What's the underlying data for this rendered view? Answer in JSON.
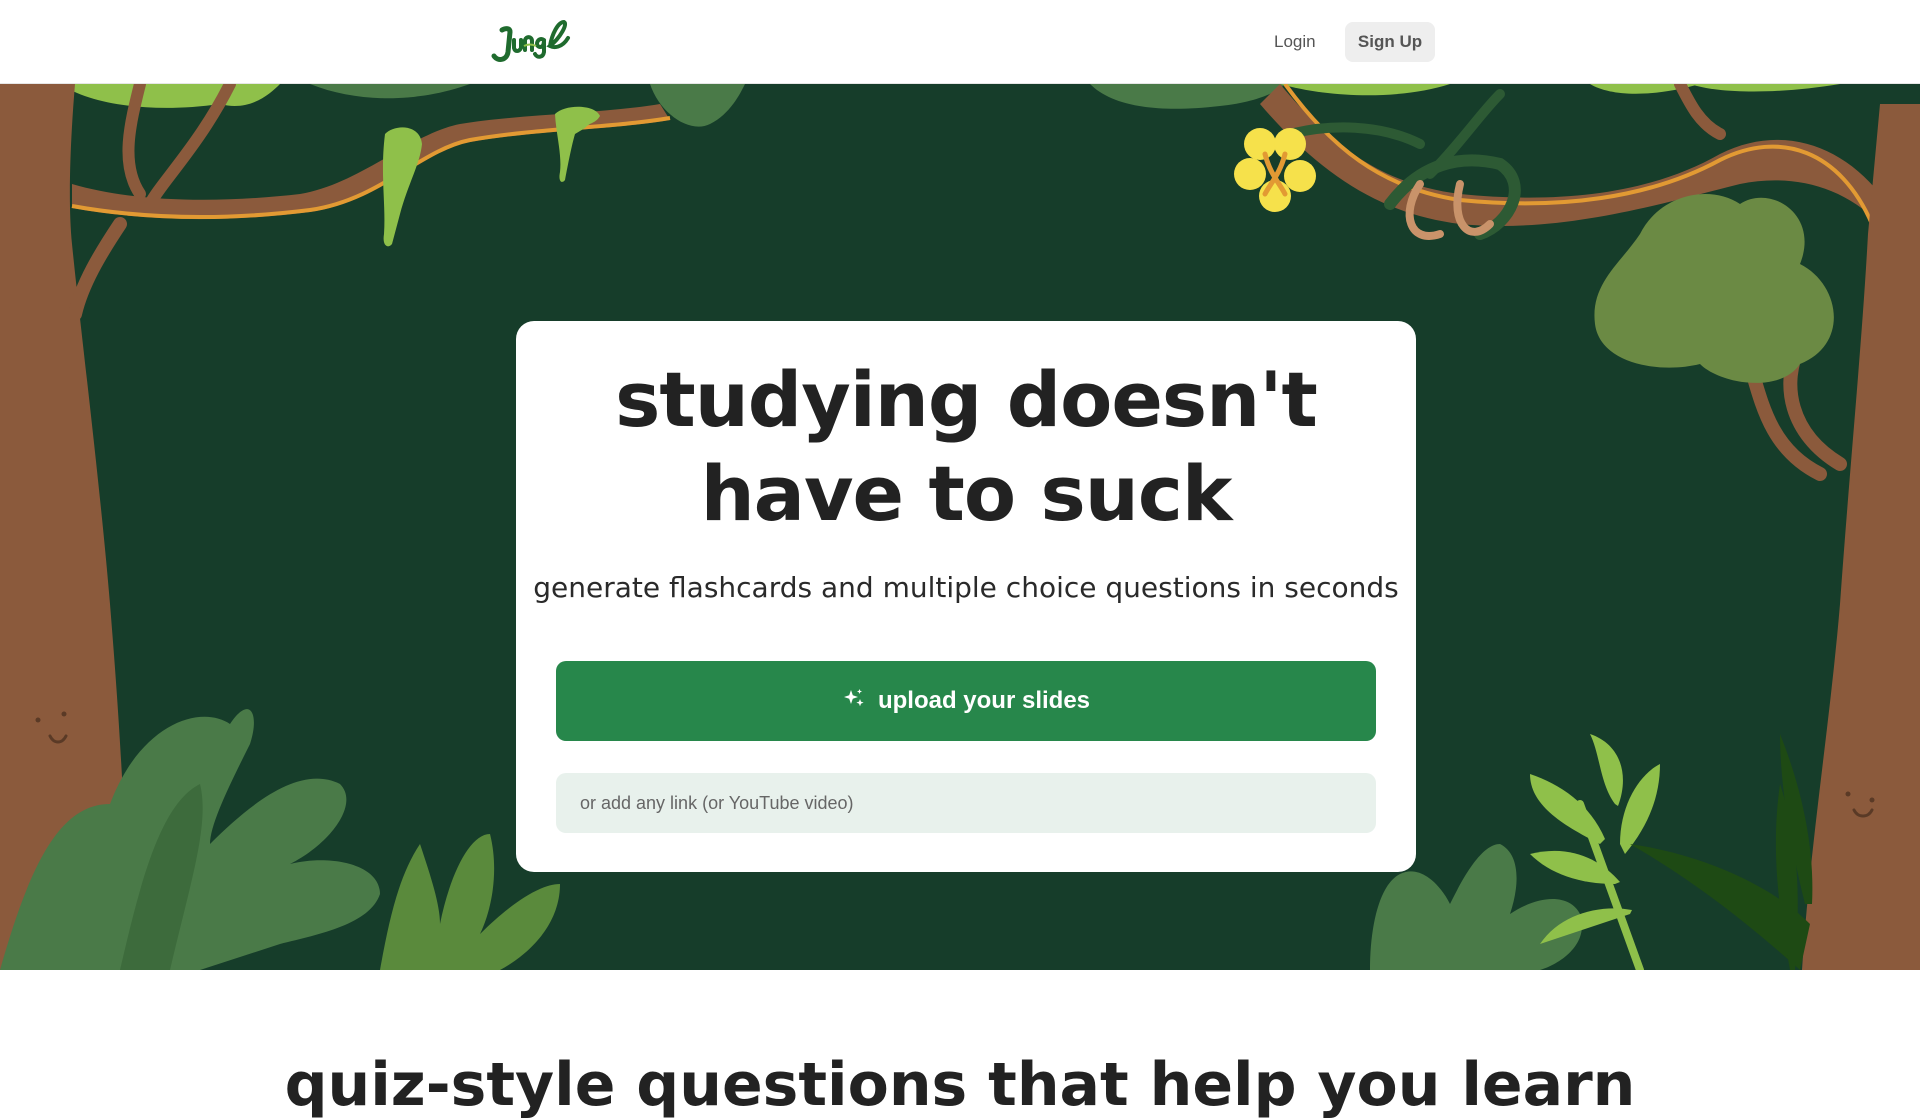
{
  "header": {
    "brand": "Jungle",
    "login_label": "Login",
    "signup_label": "Sign Up"
  },
  "hero": {
    "headline": "studying doesn't have to suck",
    "subheadline": "generate flashcards and multiple choice questions in seconds",
    "upload_label": "upload your slides",
    "upload_icon": "sparkles-icon",
    "link_placeholder": "or add any link (or YouTube video)",
    "link_value": ""
  },
  "next_section": {
    "title": "quiz-style questions that help you learn"
  },
  "colors": {
    "hero_bg": "#163d2a",
    "primary_button": "#27874b",
    "input_bg": "#e8f1ec",
    "text_dark": "#222222",
    "trunk_brown": "#8b5a3c",
    "vine_orange": "#e29a33",
    "leaf_light": "#8fc04a",
    "leaf_mid": "#4a7a48",
    "leaf_dark": "#1e4a14",
    "flower_yellow": "#f6e14b"
  }
}
